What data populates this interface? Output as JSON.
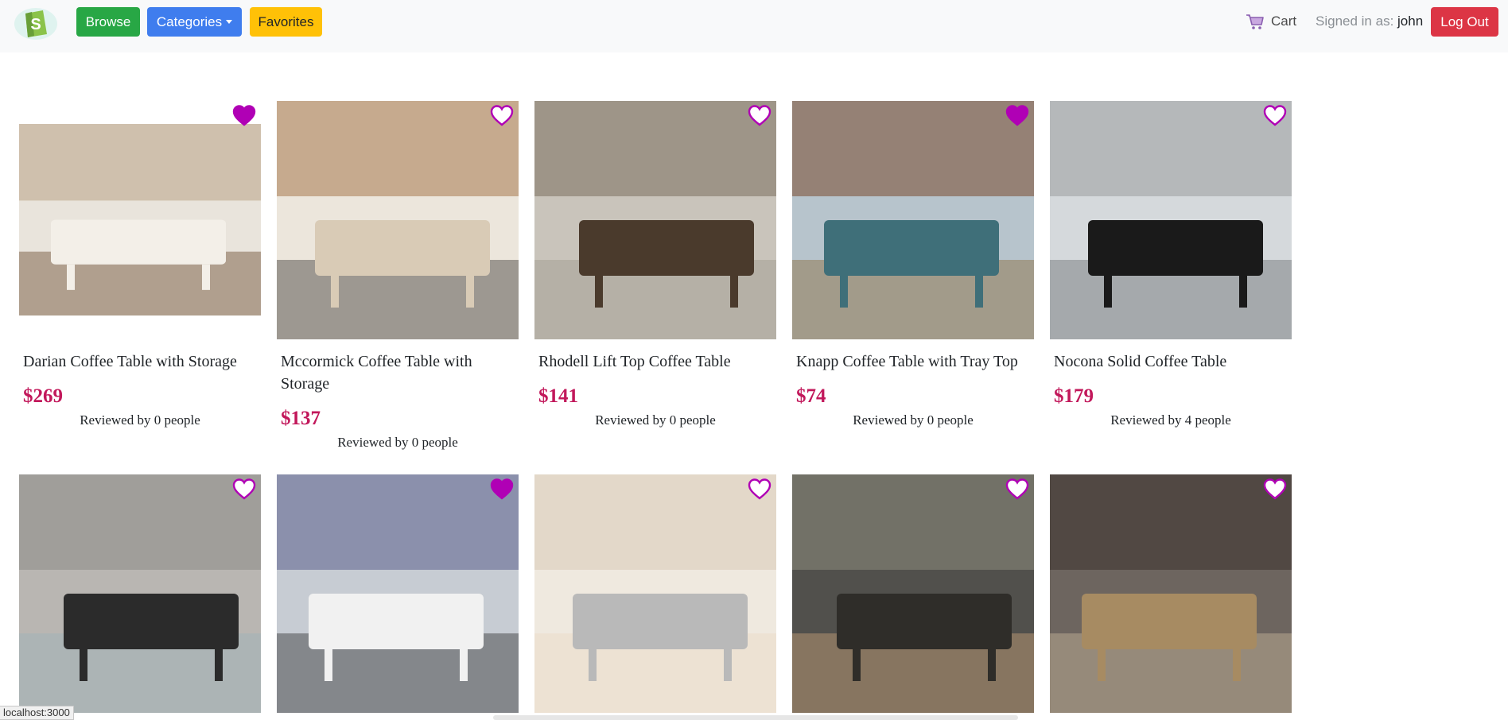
{
  "navbar": {
    "browse_label": "Browse",
    "categories_label": "Categories",
    "favorites_label": "Favorites",
    "cart_label": "Cart",
    "signed_in_prefix": "Signed in as:",
    "username": "john",
    "logout_label": "Log Out"
  },
  "products": [
    {
      "name": "Darian Coffee Table with Storage",
      "price": "$269",
      "reviews": "Reviewed by 0 people",
      "favorited": true,
      "image_icon": "coffee-table-photo"
    },
    {
      "name": "Mccormick Coffee Table with Storage",
      "price": "$137",
      "reviews": "Reviewed by 0 people",
      "favorited": false,
      "image_icon": "coffee-table-photo"
    },
    {
      "name": "Rhodell Lift Top Coffee Table",
      "price": "$141",
      "reviews": "Reviewed by 0 people",
      "favorited": false,
      "image_icon": "coffee-table-photo"
    },
    {
      "name": "Knapp Coffee Table with Tray Top",
      "price": "$74",
      "reviews": "Reviewed by 0 people",
      "favorited": true,
      "image_icon": "coffee-table-photo"
    },
    {
      "name": "Nocona Solid Coffee Table",
      "price": "$179",
      "reviews": "Reviewed by 4 people",
      "favorited": false,
      "image_icon": "coffee-table-photo"
    },
    {
      "favorited": false,
      "image_icon": "coffee-table-photo"
    },
    {
      "favorited": true,
      "image_icon": "coffee-table-photo"
    },
    {
      "favorited": false,
      "image_icon": "coffee-table-photo"
    },
    {
      "favorited": false,
      "image_icon": "coffee-table-photo"
    },
    {
      "favorited": false,
      "image_icon": "coffee-table-photo"
    }
  ],
  "status_bar": {
    "url": "localhost:3000"
  },
  "colors": {
    "browse": "#28a745",
    "categories": "#3f7dee",
    "favorites": "#ffc107",
    "logout": "#dc3545",
    "price": "#c2185b",
    "heart_filled": "#b000b5",
    "heart_outline": "#b000b5"
  }
}
